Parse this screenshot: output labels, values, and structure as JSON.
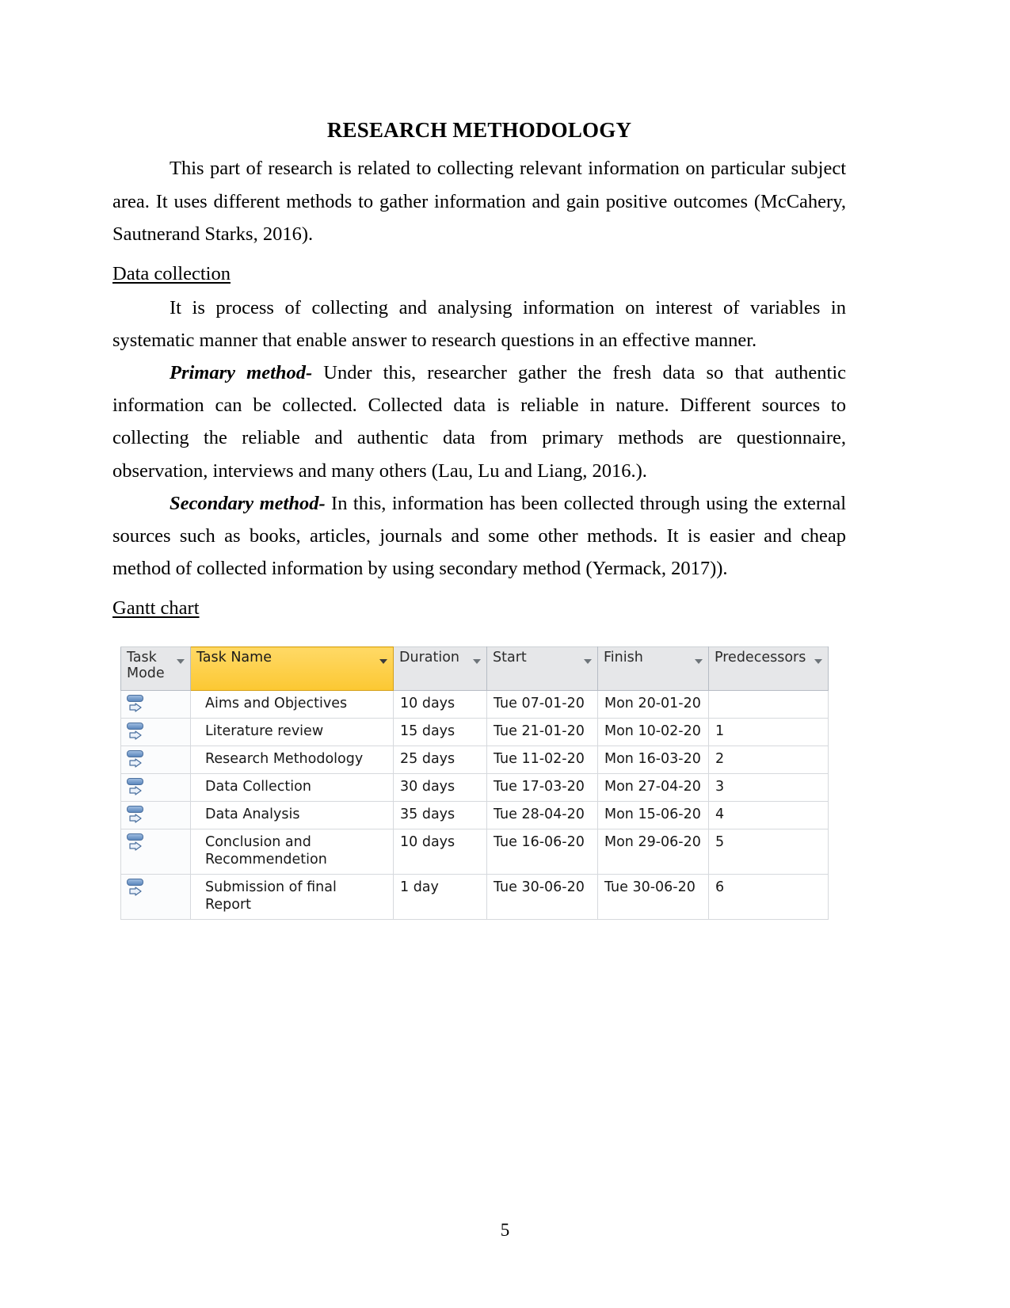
{
  "document": {
    "title": "RESEARCH METHODOLOGY",
    "page_number": "5"
  },
  "intro": {
    "paragraph": "This part of research is related to collecting relevant information on particular subject area. It uses different methods to gather information and gain positive outcomes (McCahery, Sautnerand Starks, 2016)."
  },
  "sections": {
    "data_collection": {
      "heading": "Data collection",
      "paragraph_1": "It is process of collecting and analysing information on interest of variables in systematic manner that enable answer to research questions in an effective manner.",
      "primary": {
        "lead": "Primary method-",
        "text": " Under this, researcher gather the fresh data so that authentic information can be collected. Collected data is reliable in nature. Different sources to collecting the reliable and authentic data from primary methods are questionnaire, observation, interviews and many others (Lau, Lu and Liang, 2016.)."
      },
      "secondary": {
        "lead": "Secondary method-",
        "text": " In this, information has been collected through using the external sources such as books, articles, journals and some other methods. It is easier and cheap method of collected information by using secondary method (Yermack, 2017))."
      }
    },
    "gantt": {
      "heading": "Gantt chart"
    }
  },
  "gantt_table": {
    "columns": [
      {
        "key": "task_mode",
        "label": "Task Mode",
        "highlighted": false,
        "has_filter": true
      },
      {
        "key": "task_name",
        "label": "Task Name",
        "highlighted": true,
        "has_filter": true
      },
      {
        "key": "duration",
        "label": "Duration",
        "highlighted": false,
        "has_filter": true
      },
      {
        "key": "start",
        "label": "Start",
        "highlighted": false,
        "has_filter": true
      },
      {
        "key": "finish",
        "label": "Finish",
        "highlighted": false,
        "has_filter": true
      },
      {
        "key": "predecessors",
        "label": "Predecessors",
        "highlighted": false,
        "has_filter": true
      }
    ],
    "rows": [
      {
        "task_mode_icon": "auto-scheduled-icon",
        "task_name": "Aims and Objectives",
        "duration": "10 days",
        "start": "Tue 07-01-20",
        "finish": "Mon 20-01-20",
        "predecessors": ""
      },
      {
        "task_mode_icon": "auto-scheduled-icon",
        "task_name": "Literature review",
        "duration": "15 days",
        "start": "Tue 21-01-20",
        "finish": "Mon 10-02-20",
        "predecessors": "1"
      },
      {
        "task_mode_icon": "auto-scheduled-icon",
        "task_name": "Research Methodology",
        "duration": "25 days",
        "start": "Tue 11-02-20",
        "finish": "Mon 16-03-20",
        "predecessors": "2"
      },
      {
        "task_mode_icon": "auto-scheduled-icon",
        "task_name": "Data Collection",
        "duration": "30 days",
        "start": "Tue 17-03-20",
        "finish": "Mon 27-04-20",
        "predecessors": "3"
      },
      {
        "task_mode_icon": "auto-scheduled-icon",
        "task_name": "Data Analysis",
        "duration": "35 days",
        "start": "Tue 28-04-20",
        "finish": "Mon 15-06-20",
        "predecessors": "4"
      },
      {
        "task_mode_icon": "auto-scheduled-icon",
        "task_name": "Conclusion and Recommendetion",
        "duration": "10 days",
        "start": "Tue 16-06-20",
        "finish": "Mon 29-06-20",
        "predecessors": "5"
      },
      {
        "task_mode_icon": "auto-scheduled-icon",
        "task_name": "Submission of final Report",
        "duration": "1 day",
        "start": "Tue 30-06-20",
        "finish": "Tue 30-06-20",
        "predecessors": "6"
      }
    ]
  },
  "colors": {
    "highlight_header": "#ffd257",
    "header_background": "#e6e7e9",
    "grid_line": "#d6d9dd",
    "icon_blue": "#5c87bd"
  }
}
